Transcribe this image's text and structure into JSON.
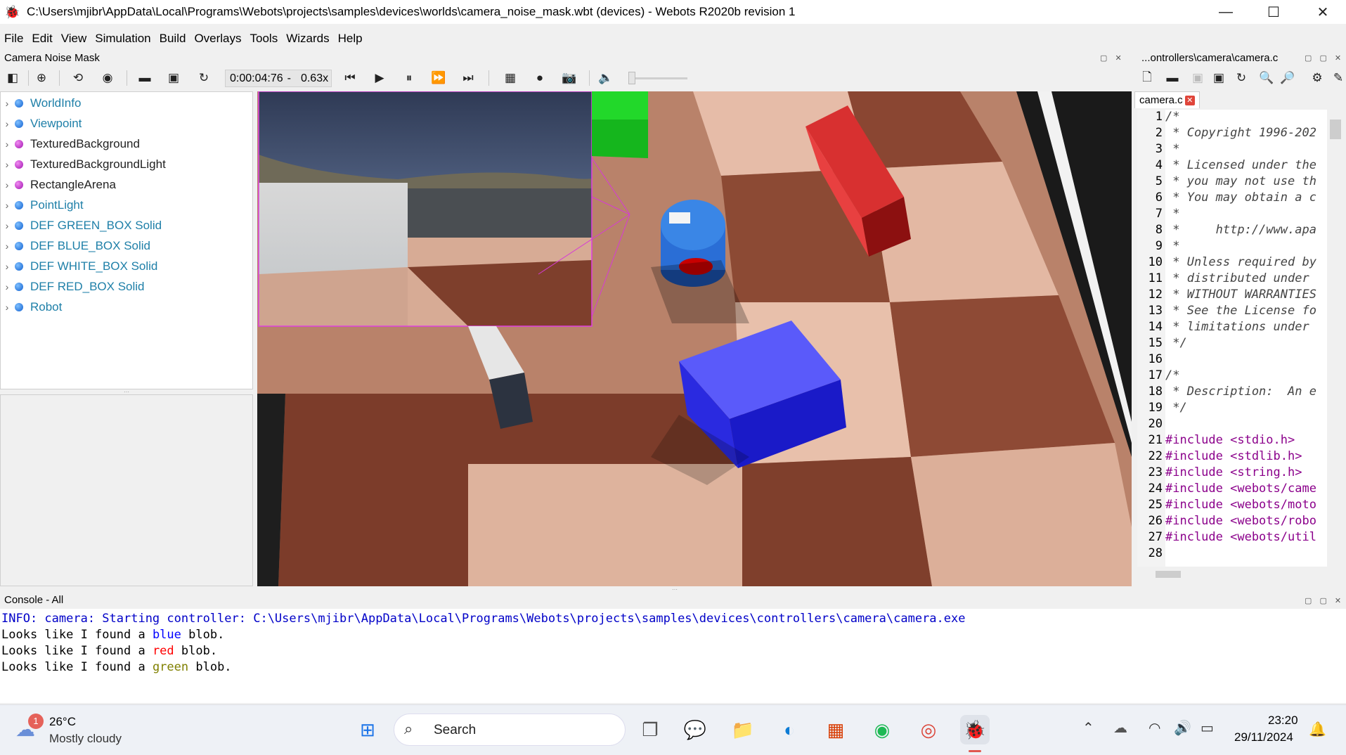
{
  "window": {
    "title": "C:\\Users\\mjibr\\AppData\\Local\\Programs\\Webots\\projects\\samples\\devices\\worlds\\camera_noise_mask.wbt (devices) - Webots R2020b revision 1",
    "minimize": "—",
    "maximize": "☐",
    "close": "✕"
  },
  "menu": [
    "File",
    "Edit",
    "View",
    "Simulation",
    "Build",
    "Overlays",
    "Tools",
    "Wizards",
    "Help"
  ],
  "left_panel_title": "Camera Noise Mask",
  "editor_panel_title": "...ontrollers\\camera\\camera.c",
  "toolbar": {
    "time": "0:00:04:76",
    "speed": "0.63x"
  },
  "scene_tree": [
    {
      "label": "WorldInfo",
      "color": "blue"
    },
    {
      "label": "Viewpoint",
      "color": "blue"
    },
    {
      "label": "TexturedBackground",
      "color": "purple"
    },
    {
      "label": "TexturedBackgroundLight",
      "color": "purple"
    },
    {
      "label": "RectangleArena",
      "color": "purple"
    },
    {
      "label": "PointLight",
      "color": "blue"
    },
    {
      "label": "DEF GREEN_BOX Solid",
      "color": "blue"
    },
    {
      "label": "DEF BLUE_BOX Solid",
      "color": "blue"
    },
    {
      "label": "DEF WHITE_BOX Solid",
      "color": "blue"
    },
    {
      "label": "DEF RED_BOX Solid",
      "color": "blue"
    },
    {
      "label": "Robot",
      "color": "blue"
    }
  ],
  "editor": {
    "tab": "camera.c",
    "lines": [
      {
        "n": "1",
        "text": "/*",
        "kind": "comment"
      },
      {
        "n": "2",
        "text": " * Copyright 1996-202",
        "kind": "comment"
      },
      {
        "n": "3",
        "text": " *",
        "kind": "comment"
      },
      {
        "n": "4",
        "text": " * Licensed under the",
        "kind": "comment"
      },
      {
        "n": "5",
        "text": " * you may not use th",
        "kind": "comment"
      },
      {
        "n": "6",
        "text": " * You may obtain a c",
        "kind": "comment"
      },
      {
        "n": "7",
        "text": " *",
        "kind": "comment"
      },
      {
        "n": "8",
        "text": " *     http://www.apa",
        "kind": "comment"
      },
      {
        "n": "9",
        "text": " *",
        "kind": "comment"
      },
      {
        "n": "10",
        "text": " * Unless required by",
        "kind": "comment"
      },
      {
        "n": "11",
        "text": " * distributed under",
        "kind": "comment"
      },
      {
        "n": "12",
        "text": " * WITHOUT WARRANTIES",
        "kind": "comment"
      },
      {
        "n": "13",
        "text": " * See the License fo",
        "kind": "comment"
      },
      {
        "n": "14",
        "text": " * limitations under",
        "kind": "comment"
      },
      {
        "n": "15",
        "text": " */",
        "kind": "comment"
      },
      {
        "n": "16",
        "text": "",
        "kind": "comment"
      },
      {
        "n": "17",
        "text": "/*",
        "kind": "comment"
      },
      {
        "n": "18",
        "text": " * Description:  An e",
        "kind": "comment"
      },
      {
        "n": "19",
        "text": " */",
        "kind": "comment"
      },
      {
        "n": "20",
        "text": "",
        "kind": "comment"
      },
      {
        "n": "21",
        "text": "#include <stdio.h>",
        "kind": "include"
      },
      {
        "n": "22",
        "text": "#include <stdlib.h>",
        "kind": "include"
      },
      {
        "n": "23",
        "text": "#include <string.h>",
        "kind": "include"
      },
      {
        "n": "24",
        "text": "#include <webots/came",
        "kind": "include"
      },
      {
        "n": "25",
        "text": "#include <webots/moto",
        "kind": "include"
      },
      {
        "n": "26",
        "text": "#include <webots/robo",
        "kind": "include"
      },
      {
        "n": "27",
        "text": "#include <webots/util",
        "kind": "include"
      },
      {
        "n": "28",
        "text": "",
        "kind": "comment"
      }
    ]
  },
  "console": {
    "title": "Console - All",
    "info": "INFO: camera: Starting controller: C:\\Users\\mjibr\\AppData\\Local\\Programs\\Webots\\projects\\samples\\devices\\controllers\\camera\\camera.exe",
    "lines": [
      {
        "prefix": "Looks like I found a ",
        "color_word": "blue",
        "suffix": " blob.",
        "color": "#0000ff"
      },
      {
        "prefix": "Looks like I found a ",
        "color_word": "red",
        "suffix": " blob.",
        "color": "#ff0000"
      },
      {
        "prefix": "Looks like I found a ",
        "color_word": "green",
        "suffix": " blob.",
        "color": "#808000"
      }
    ]
  },
  "taskbar": {
    "weather_badge": "1",
    "temperature": "26°C",
    "weather": "Mostly cloudy",
    "search": "Search",
    "time": "23:20",
    "date": "29/11/2024"
  }
}
